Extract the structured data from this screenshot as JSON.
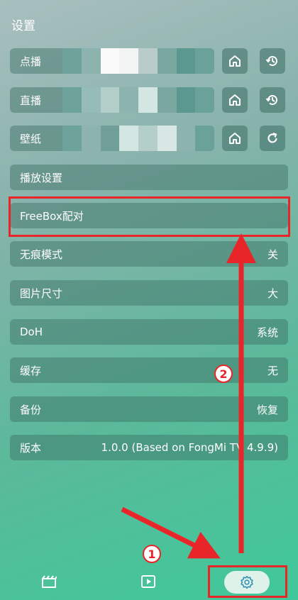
{
  "page_title": "设置",
  "source_rows": [
    {
      "label": "点播",
      "btn2_icon": "history-icon"
    },
    {
      "label": "直播",
      "btn2_icon": "history-icon"
    },
    {
      "label": "壁纸",
      "btn2_icon": "refresh-icon"
    }
  ],
  "settings": [
    {
      "label": "播放设置",
      "value": ""
    },
    {
      "label": "FreeBox配对",
      "value": ""
    },
    {
      "label": "无痕模式",
      "value": "关"
    },
    {
      "label": "图片尺寸",
      "value": "大"
    },
    {
      "label": "DoH",
      "value": "系统"
    },
    {
      "label": "缓存",
      "value": "无"
    },
    {
      "label": "备份",
      "value": "恢复"
    },
    {
      "label": "版本",
      "value": "1.0.0 (Based on FongMi TV 4.9.9)"
    }
  ],
  "annotations": {
    "step1": "1",
    "step2": "2",
    "color": "#e8262a"
  },
  "bottom_nav": [
    {
      "icon": "film-icon"
    },
    {
      "icon": "play-icon"
    },
    {
      "icon": "settings-gear-icon",
      "selected": true
    }
  ]
}
